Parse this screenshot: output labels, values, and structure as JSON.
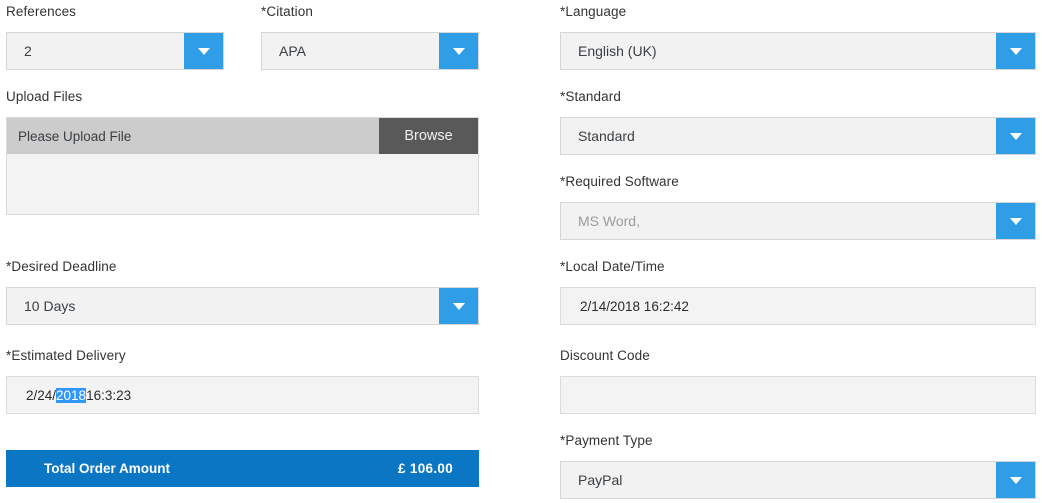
{
  "theme": {
    "accent_blue": "#2f9ee6",
    "total_bar_blue": "#0b76c4",
    "browse_gray": "#595959",
    "upload_bar_gray": "#cccccc",
    "field_gray": "#f2f2f2",
    "selection_blue": "#3297fd"
  },
  "left": {
    "references": {
      "label": "References",
      "value": "2"
    },
    "citation": {
      "label": "*Citation",
      "value": "APA"
    },
    "upload_files": {
      "label": "Upload Files",
      "placeholder": "Please Upload File",
      "browse_label": "Browse"
    },
    "desired_deadline": {
      "label": "*Desired Deadline",
      "value": "10 Days"
    },
    "estimated_delivery": {
      "label": "*Estimated Delivery",
      "value_before": "2/24/",
      "value_selected": "2018",
      "value_after": " 16:3:23"
    },
    "total": {
      "label": "Total Order Amount",
      "amount": "£ 106.00"
    }
  },
  "right": {
    "language": {
      "label": "*Language",
      "value": "English (UK)"
    },
    "standard": {
      "label": "*Standard",
      "value": "Standard"
    },
    "required_software": {
      "label": "*Required Software",
      "value": "MS Word,"
    },
    "local_datetime": {
      "label": "*Local Date/Time",
      "value": "2/14/2018 16:2:42"
    },
    "discount_code": {
      "label": "Discount Code",
      "value": ""
    },
    "payment_type": {
      "label": "*Payment Type",
      "value": "PayPal"
    }
  }
}
